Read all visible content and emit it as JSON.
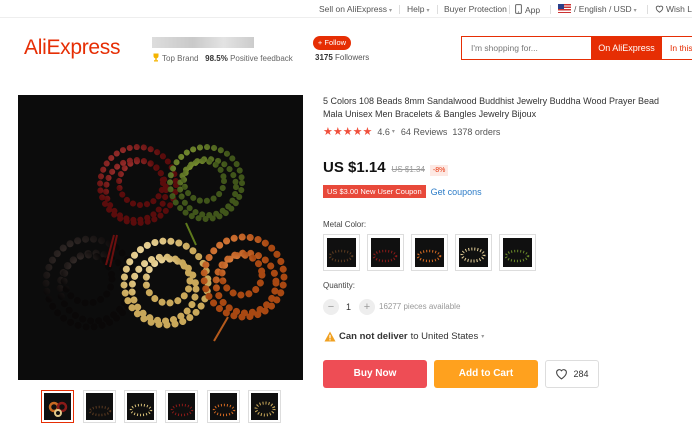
{
  "topbar": {
    "sell": "Sell on AliExpress",
    "help": "Help",
    "buyer_protection": "Buyer Protection",
    "app": "App",
    "locale": "/ English / USD",
    "wishlist": "Wish L"
  },
  "header": {
    "logo": "AliExpress",
    "top_brand": "Top Brand",
    "positive_pct": "98.5%",
    "positive_label": "Positive feedback",
    "follow": "+ Follow",
    "followers_count": "3175",
    "followers_label": "Followers",
    "search_placeholder": "I'm shopping for...",
    "search_button": "On AliExpress",
    "search_store": "In this"
  },
  "product": {
    "title": "5 Colors 108 Beads 8mm Sandalwood Buddhist Jewelry Buddha Wood Prayer Bead Mala Unisex Men Bracelets & Bangles Jewelry Bijoux",
    "stars": "★★★★★",
    "rating": "4.6",
    "reviews": "64 Reviews",
    "orders": "1378 orders",
    "price": "US $1.14",
    "old_price": "US $1.34",
    "discount": "-8%",
    "coupon": "US $3.00 New User Coupon",
    "get_coupons": "Get coupons",
    "metal_color_label": "Metal Color:",
    "quantity_label": "Quantity:",
    "quantity": "1",
    "qty_minus": "−",
    "qty_plus": "+",
    "stock": "16277 pieces available",
    "cannot_deliver": "Can not deliver",
    "deliver_to": "to United States",
    "buy_now": "Buy Now",
    "add_to_cart": "Add to Cart",
    "wish_count": "284"
  },
  "colors": {
    "brand": "#e62e04",
    "buy": "#ee4d55",
    "cart": "#ffa11e",
    "link": "#2c7cc8",
    "beads": [
      "#7a1514",
      "#5e7a1c",
      "#141010",
      "#e8d29a",
      "#d66a22"
    ]
  },
  "icons": [
    "chevron-down-icon",
    "phone-icon",
    "us-flag-icon",
    "heart-icon",
    "trophy-icon",
    "warning-icon"
  ]
}
